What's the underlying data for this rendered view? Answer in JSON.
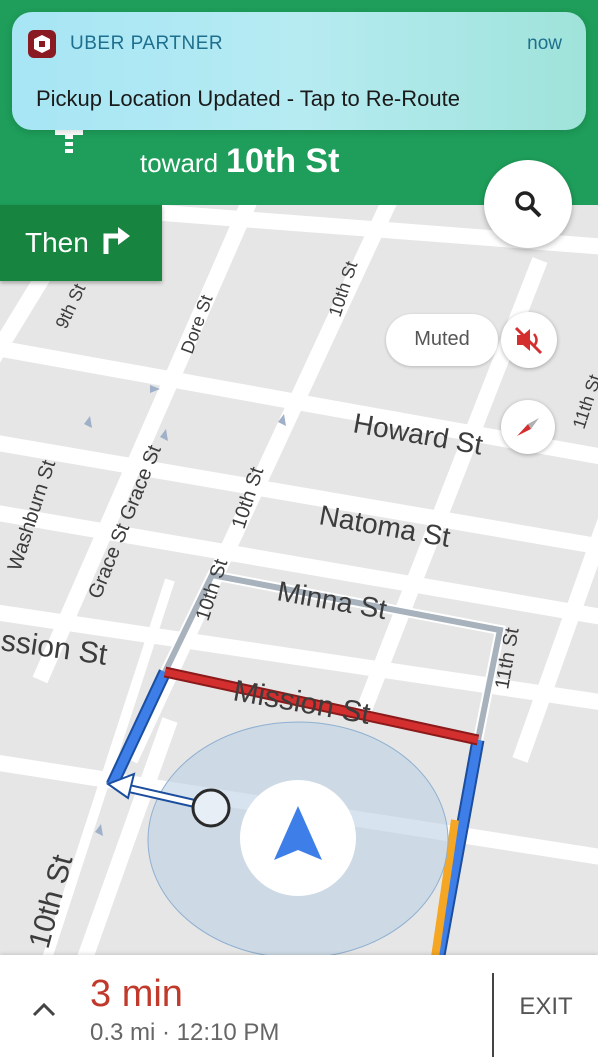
{
  "notification": {
    "app_name": "UBER PARTNER",
    "time": "now",
    "message": "Pickup Location Updated - Tap to Re-Route"
  },
  "navigation": {
    "toward_label": "toward",
    "toward_street": "10th St",
    "then_label": "Then",
    "then_maneuver": "turn-right-icon"
  },
  "map": {
    "streets": {
      "ninth_st": "9th St",
      "dore_st": "Dore St",
      "tenth_st_top": "10th St",
      "eleventh_st_right": "11th St",
      "howard_st": "Howard St",
      "washburn_st": "Washburn St",
      "grace_st": "Grace St Grace St",
      "tenth_st_mid": "10th St",
      "natoma_st": "Natoma St",
      "minna_st": "Minna St",
      "tenth_st_route": "10th St",
      "eleventh_st_route": "11th St",
      "mission_st_left": "ssion St",
      "mission_st": "Mission St",
      "tenth_st_bottom": "10th St"
    },
    "controls": {
      "search_icon": "search-icon",
      "muted_label": "Muted",
      "mute_icon": "volume-off-icon",
      "compass_icon": "compass-icon"
    },
    "colors": {
      "route_blue": "#3d7ee8",
      "traffic_red": "#d32f2f",
      "traffic_orange": "#f5a623",
      "banner_green": "#1e9e5a"
    }
  },
  "bottom_bar": {
    "eta": "3 min",
    "details": "0.3 mi · 12:10 PM",
    "exit_label": "EXIT"
  }
}
